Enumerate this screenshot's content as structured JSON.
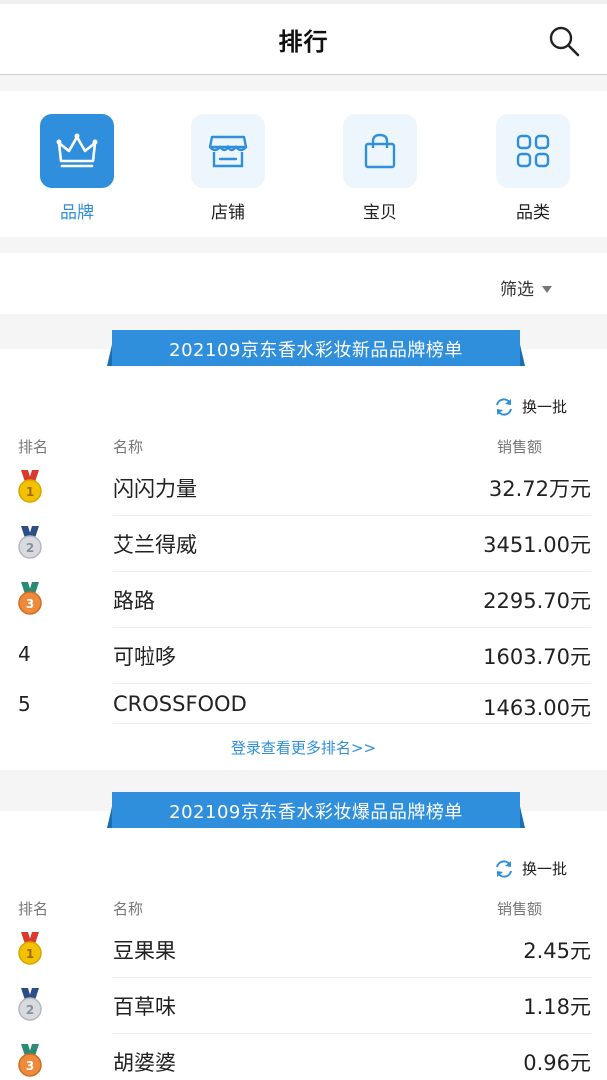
{
  "header": {
    "title": "排行"
  },
  "tabs": [
    {
      "label": "品牌",
      "icon": "crown-icon",
      "active": true
    },
    {
      "label": "店铺",
      "icon": "store-icon",
      "active": false
    },
    {
      "label": "宝贝",
      "icon": "bag-icon",
      "active": false
    },
    {
      "label": "品类",
      "icon": "grid-icon",
      "active": false
    }
  ],
  "filter": {
    "label": "筛选"
  },
  "colors": {
    "accent": "#2f8fdc",
    "gold": "#f2c200",
    "silver": "#c9cdd2",
    "bronze": "#e8863a"
  },
  "lists": [
    {
      "title": "202109京东香水彩妆新品品牌榜单",
      "refresh": "换一批",
      "columns": {
        "rank": "排名",
        "name": "名称",
        "sales": "销售额"
      },
      "rows": [
        {
          "rank": "1",
          "name": "闪闪力量",
          "value": "32.72万元"
        },
        {
          "rank": "2",
          "name": "艾兰得威",
          "value": "3451.00元"
        },
        {
          "rank": "3",
          "name": "路路",
          "value": "2295.70元"
        },
        {
          "rank": "4",
          "name": "可啦哆",
          "value": "1603.70元"
        },
        {
          "rank": "5",
          "name": "CROSSFOOD",
          "value": "1463.00元"
        }
      ],
      "more": "登录查看更多排名>>"
    },
    {
      "title": "202109京东香水彩妆爆品品牌榜单",
      "refresh": "换一批",
      "columns": {
        "rank": "排名",
        "name": "名称",
        "sales": "销售额"
      },
      "rows": [
        {
          "rank": "1",
          "name": "豆果果",
          "value": "2.45元"
        },
        {
          "rank": "2",
          "name": "百草味",
          "value": "1.18元"
        },
        {
          "rank": "3",
          "name": "胡婆婆",
          "value": "0.96元"
        }
      ]
    }
  ]
}
